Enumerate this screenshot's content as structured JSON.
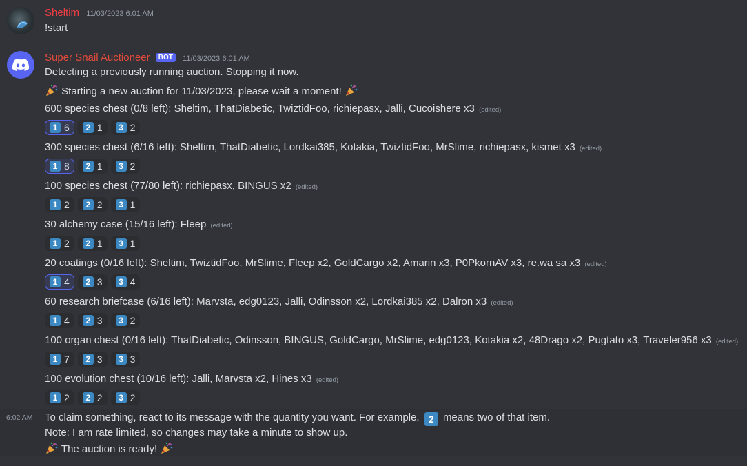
{
  "messages": {
    "user": {
      "author": "Sheltim",
      "timestamp": "11/03/2023 6:01 AM",
      "content": "!start"
    },
    "bot": {
      "author": "Super Snail Auctioneer",
      "bot_tag": "BOT",
      "timestamp": "11/03/2023 6:01 AM",
      "line1": "Detecting a previously running auction. Stopping it now.",
      "line2": "Starting a new auction for 11/03/2023, please wait a moment!",
      "edited_label": "(edited)",
      "auctions": [
        {
          "text": "600 species chest (0/8 left): Sheltim, ThatDiabetic, TwiztidFoo, richiepasx, Jalli, Cucoishere x3",
          "reactions": [
            {
              "key": "1",
              "count": "6",
              "me": true
            },
            {
              "key": "2",
              "count": "1",
              "me": false
            },
            {
              "key": "3",
              "count": "2",
              "me": false
            }
          ]
        },
        {
          "text": "300 species chest (6/16 left): Sheltim, ThatDiabetic, Lordkai385, Kotakia, TwiztidFoo, MrSlime, richiepasx, kismet x3",
          "reactions": [
            {
              "key": "1",
              "count": "8",
              "me": true
            },
            {
              "key": "2",
              "count": "1",
              "me": false
            },
            {
              "key": "3",
              "count": "2",
              "me": false
            }
          ]
        },
        {
          "text": "100 species chest (77/80 left): richiepasx, BINGUS x2",
          "reactions": [
            {
              "key": "1",
              "count": "2",
              "me": false
            },
            {
              "key": "2",
              "count": "2",
              "me": false
            },
            {
              "key": "3",
              "count": "1",
              "me": false
            }
          ]
        },
        {
          "text": "30 alchemy case (15/16 left): Fleep",
          "reactions": [
            {
              "key": "1",
              "count": "2",
              "me": false
            },
            {
              "key": "2",
              "count": "1",
              "me": false
            },
            {
              "key": "3",
              "count": "1",
              "me": false
            }
          ]
        },
        {
          "text": "20 coatings (0/16 left): Sheltim, TwiztidFoo, MrSlime, Fleep x2, GoldCargo x2, Amarin x3, P0PkornAV x3, re.wa sa x3",
          "reactions": [
            {
              "key": "1",
              "count": "4",
              "me": true
            },
            {
              "key": "2",
              "count": "3",
              "me": false
            },
            {
              "key": "3",
              "count": "4",
              "me": false
            }
          ]
        },
        {
          "text": "60 research briefcase (6/16 left): Marvsta, edg0123, Jalli, Odinsson x2, Lordkai385 x2, Dalron x3",
          "reactions": [
            {
              "key": "1",
              "count": "4",
              "me": false
            },
            {
              "key": "2",
              "count": "3",
              "me": false
            },
            {
              "key": "3",
              "count": "2",
              "me": false
            }
          ]
        },
        {
          "text": "100 organ chest (0/16 left): ThatDiabetic, Odinsson, BINGUS, GoldCargo, MrSlime, edg0123, Kotakia x2, 48Drago x2, Pugtato x3, Traveler956 x3",
          "reactions": [
            {
              "key": "1",
              "count": "7",
              "me": false
            },
            {
              "key": "2",
              "count": "3",
              "me": false
            },
            {
              "key": "3",
              "count": "3",
              "me": false
            }
          ]
        },
        {
          "text": "100 evolution chest (10/16 left): Jalli, Marvsta x2, Hines x3",
          "reactions": [
            {
              "key": "1",
              "count": "2",
              "me": false
            },
            {
              "key": "2",
              "count": "2",
              "me": false
            },
            {
              "key": "3",
              "count": "2",
              "me": false
            }
          ]
        }
      ]
    },
    "followup": {
      "time": "6:02 AM",
      "claim_before": "To claim something, react to its message with the quantity you want. For example,",
      "claim_key": "2",
      "claim_after": "means two of that item.",
      "note": "Note: I am rate limited, so changes may take a minute to show up.",
      "ready": "The auction is ready!"
    }
  },
  "colors": {
    "background": "#313338",
    "author_name": "#e64a3b",
    "bot_tag": "#5865f2",
    "keycap": "#3b88c3",
    "reaction_bg": "#2b2d31",
    "reaction_me_border": "#5865f2"
  },
  "icons": {
    "bot_avatar": "discord-logo-icon",
    "party": "party-popper-icon",
    "keycap": "keycap-digit-icon"
  }
}
